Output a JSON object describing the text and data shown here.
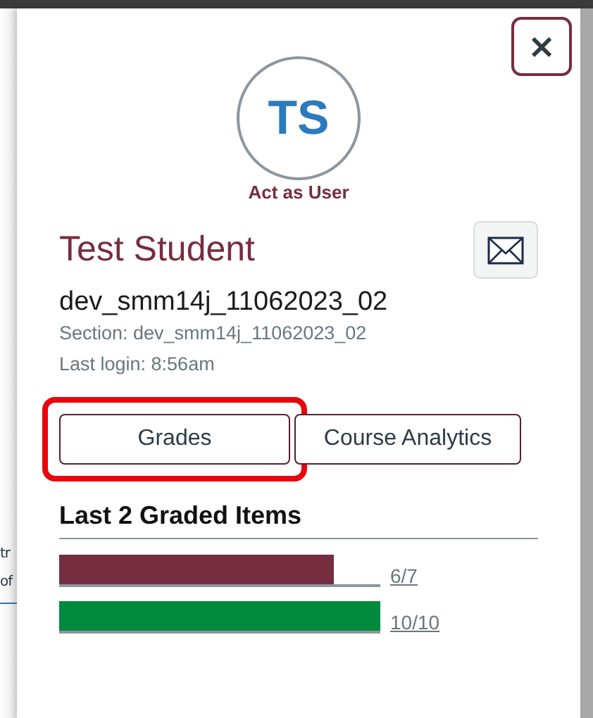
{
  "background_page": {
    "fragments": [
      "tr",
      "of"
    ]
  },
  "tray": {
    "close_label": "×",
    "avatar_initials": "TS",
    "act_as_user": "Act as User",
    "name": "Test Student",
    "login_id": "dev_smm14j_11062023_02",
    "section": "Section: dev_smm14j_11062023_02",
    "last_login": "Last login: 8:56am",
    "buttons": [
      {
        "label": "Grades",
        "highlighted": true
      },
      {
        "label": "Course Analytics",
        "highlighted": false
      }
    ],
    "graded_heading": "Last 2 Graded Items",
    "graded_items": [
      {
        "score": "6/7",
        "level": 0.857,
        "color": "#772d40"
      },
      {
        "score": "10/10",
        "level": 1,
        "color": "#008a3e"
      }
    ]
  }
}
